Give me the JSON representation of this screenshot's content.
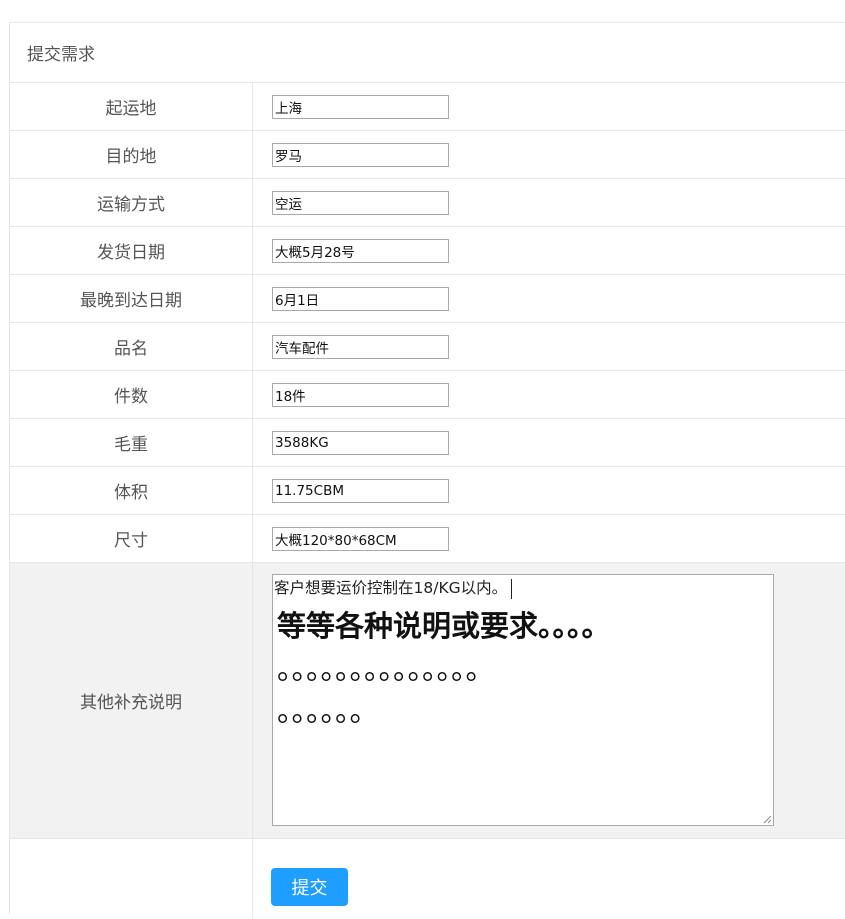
{
  "form": {
    "title": "提交需求",
    "fields": [
      {
        "label": "起运地",
        "value": "上海"
      },
      {
        "label": "目的地",
        "value": "罗马"
      },
      {
        "label": "运输方式",
        "value": "空运"
      },
      {
        "label": "发货日期",
        "value": "大概5月28号"
      },
      {
        "label": "最晚到达日期",
        "value": "6月1日"
      },
      {
        "label": "品名",
        "value": "汽车配件"
      },
      {
        "label": "件数",
        "value": "18件"
      },
      {
        "label": "毛重",
        "value": "3588KG"
      },
      {
        "label": "体积",
        "value": "11.75CBM"
      },
      {
        "label": "尺寸",
        "value": "大概120*80*68CM"
      }
    ],
    "notes": {
      "label": "其他补充说明",
      "line1": "客户想要运价控制在18/KG以内。",
      "line2": "等等各种说明或要求。。。。",
      "line3": "。。。。。。。。。。。。。。",
      "line4": "。。。。。。"
    },
    "submit_label": "提交"
  },
  "colors": {
    "accent": "#1e9fff",
    "border": "#e6e6e6",
    "notes_row_bg": "#f2f2f2"
  }
}
